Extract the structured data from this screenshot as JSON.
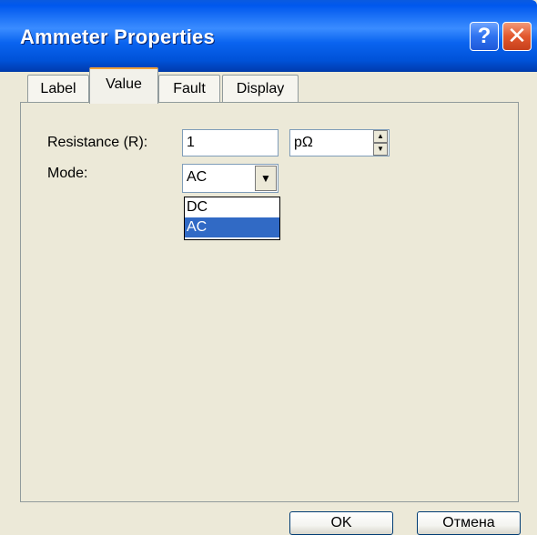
{
  "window": {
    "title": "Ammeter Properties",
    "help_glyph": "?",
    "close_glyph": "✕"
  },
  "tabs": [
    {
      "label": "Label",
      "active": false
    },
    {
      "label": "Value",
      "active": true
    },
    {
      "label": "Fault",
      "active": false
    },
    {
      "label": "Display",
      "active": false
    }
  ],
  "value_tab": {
    "resistance_label": "Resistance (R):",
    "resistance_value": "1",
    "resistance_unit": "pΩ",
    "mode_label": "Mode:",
    "mode_value": "AC",
    "mode_options": [
      "DC",
      "AC"
    ],
    "mode_highlighted": "AC"
  },
  "buttons": {
    "ok": "OK",
    "cancel": "Отмена"
  },
  "colors": {
    "titlebar": "#0058ee",
    "selection": "#316ac5",
    "close_button": "#e2582e",
    "tab_highlight": "#f1a23a"
  },
  "icons": {
    "help": "help-icon",
    "close": "close-icon",
    "combo_arrow": "chevron-down-icon",
    "spin_up": "spin-up-icon",
    "spin_down": "spin-down-icon"
  }
}
